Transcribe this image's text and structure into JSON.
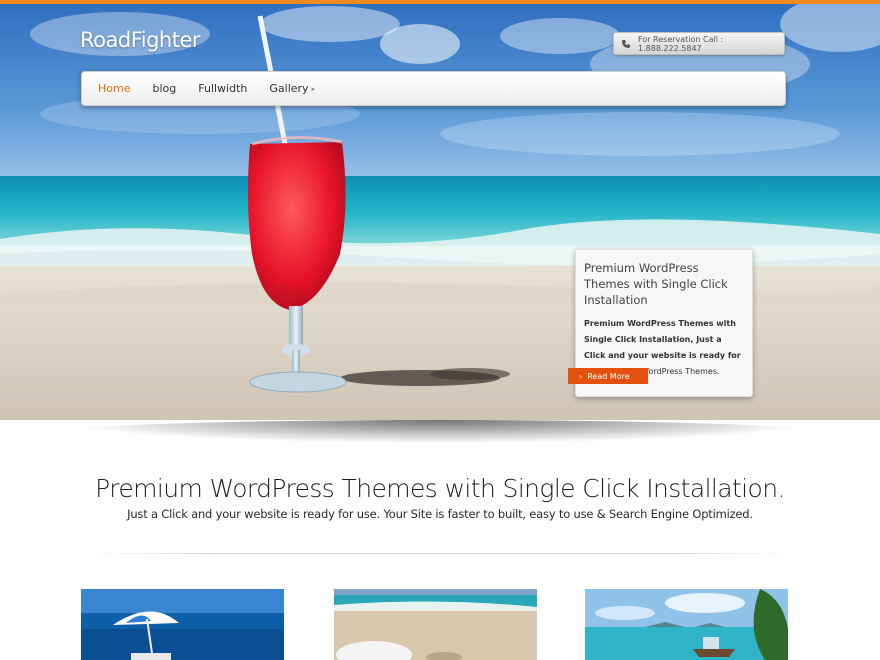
{
  "site": {
    "logo": "RoadFighter",
    "reservation": "For Reservation Call : 1.888.222.5847"
  },
  "nav": {
    "items": [
      {
        "label": "Home",
        "active": true
      },
      {
        "label": "blog"
      },
      {
        "label": "Fullwidth"
      },
      {
        "label": "Gallery",
        "has_submenu": true
      }
    ],
    "active_color": "#e46c0a"
  },
  "slider": {
    "caption_title": "Premium WordPress Themes with Single Click Installation",
    "caption_text_bold": "Premium WordPress Themes with Single Click Installation, Just a Click and your website is ready for use.",
    "caption_text_normal": "Premium WordPress Themes.",
    "read_more": "Read More",
    "read_more_color": "#e4510f"
  },
  "intro": {
    "headline": "Premium WordPress Themes with Single Click Installation.",
    "subline": "Just a Click and your website is ready for use. Your Site is faster to built, easy to use & Search Engine Optimized."
  },
  "colors": {
    "accent": "#f08a1c"
  },
  "icons": {
    "phone": "phone-icon",
    "submenu": "chevron-right-icon"
  }
}
